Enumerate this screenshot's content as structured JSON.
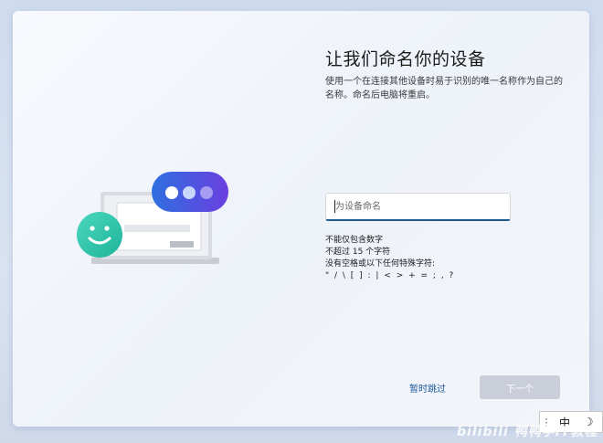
{
  "page": {
    "title": "让我们命名你的设备",
    "description": "使用一个在连接其他设备时易于识别的唯一名称作为自己的名称。命名后电脑将重启。"
  },
  "device_name_input": {
    "placeholder": "为设备命名",
    "value": ""
  },
  "rules": [
    "不能仅包含数字",
    "不超过 15 个字符",
    "没有空格或以下任何特殊字符:",
    "\" / \\ [ ] : | < > + = ; , ?"
  ],
  "actions": {
    "skip_label": "暂时跳过",
    "next_label": "下一个"
  },
  "ime": {
    "grip": "⋮",
    "mode": "中",
    "moon": "☽"
  },
  "watermark": "bilibili 鸭鸭学IT教程",
  "colors": {
    "accent": "#1e5a88",
    "link": "#1e5a9a",
    "disabled_button": "#c9ced8",
    "bubble_gradient_start": "#2f6fe0",
    "bubble_gradient_end": "#6a3fe0",
    "smiley": "#2fc7ad"
  }
}
